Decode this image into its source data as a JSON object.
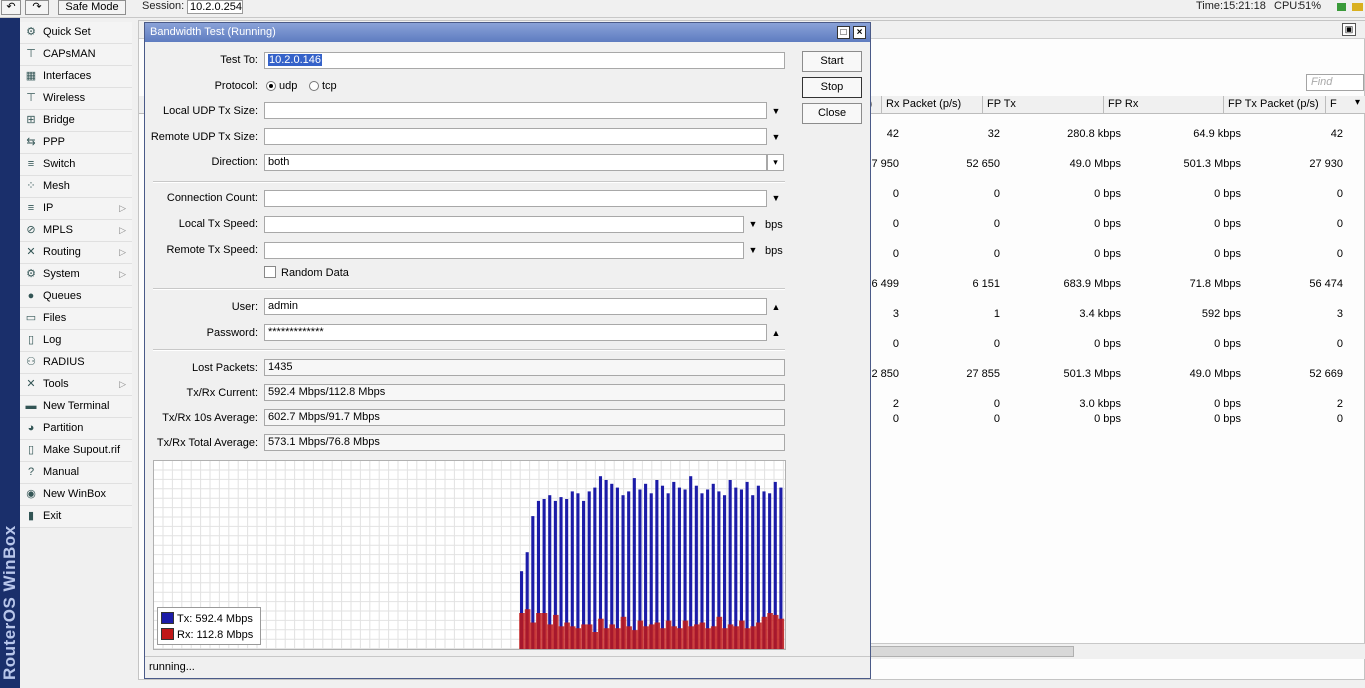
{
  "topbar": {
    "safe_mode": "Safe Mode",
    "session_label": "Session:",
    "session_value": "10.2.0.254",
    "time_label": "Time:",
    "time_value": "15:21:18",
    "cpu_label": "CPU:",
    "cpu_value": "51%"
  },
  "brand": "RouterOS WinBox",
  "menu": [
    {
      "label": "Quick Set",
      "icon": "quickset-icon",
      "glyph": "⚙"
    },
    {
      "label": "CAPsMAN",
      "icon": "capsman-icon",
      "glyph": "⊤"
    },
    {
      "label": "Interfaces",
      "icon": "interfaces-icon",
      "glyph": "▦"
    },
    {
      "label": "Wireless",
      "icon": "wireless-icon",
      "glyph": "⊤"
    },
    {
      "label": "Bridge",
      "icon": "bridge-icon",
      "glyph": "⊞"
    },
    {
      "label": "PPP",
      "icon": "ppp-icon",
      "glyph": "⇆"
    },
    {
      "label": "Switch",
      "icon": "switch-icon",
      "glyph": "≡"
    },
    {
      "label": "Mesh",
      "icon": "mesh-icon",
      "glyph": "⁘"
    },
    {
      "label": "IP",
      "icon": "ip-icon",
      "glyph": "≡",
      "sub": true
    },
    {
      "label": "MPLS",
      "icon": "mpls-icon",
      "glyph": "⊘",
      "sub": true
    },
    {
      "label": "Routing",
      "icon": "routing-icon",
      "glyph": "✕",
      "sub": true
    },
    {
      "label": "System",
      "icon": "system-icon",
      "glyph": "⚙",
      "sub": true
    },
    {
      "label": "Queues",
      "icon": "queues-icon",
      "glyph": "●"
    },
    {
      "label": "Files",
      "icon": "files-icon",
      "glyph": "▭"
    },
    {
      "label": "Log",
      "icon": "log-icon",
      "glyph": "▯"
    },
    {
      "label": "RADIUS",
      "icon": "radius-icon",
      "glyph": "⚇"
    },
    {
      "label": "Tools",
      "icon": "tools-icon",
      "glyph": "✕",
      "sub": true
    },
    {
      "label": "New Terminal",
      "icon": "terminal-icon",
      "glyph": "▬"
    },
    {
      "label": "Partition",
      "icon": "partition-icon",
      "glyph": "◕"
    },
    {
      "label": "Make Supout.rif",
      "icon": "supout-icon",
      "glyph": "▯"
    },
    {
      "label": "Manual",
      "icon": "manual-icon",
      "glyph": "?"
    },
    {
      "label": "New WinBox",
      "icon": "winbox-icon",
      "glyph": "◉"
    },
    {
      "label": "Exit",
      "icon": "exit-icon",
      "glyph": "▮"
    }
  ],
  "bgtable": {
    "find_placeholder": "Find",
    "headers": [
      "s)",
      "Rx Packet (p/s)",
      "FP Tx",
      "FP Rx",
      "FP Tx Packet (p/s)",
      "F"
    ],
    "rows": [
      [
        "42",
        "32",
        "280.8 kbps",
        "64.9 kbps",
        "42"
      ],
      [
        "7 950",
        "52 650",
        "49.0 Mbps",
        "501.3 Mbps",
        "27 930"
      ],
      [
        "0",
        "0",
        "0 bps",
        "0 bps",
        "0"
      ],
      [
        "0",
        "0",
        "0 bps",
        "0 bps",
        "0"
      ],
      [
        "0",
        "0",
        "0 bps",
        "0 bps",
        "0"
      ],
      [
        "6 499",
        "6 151",
        "683.9 Mbps",
        "71.8 Mbps",
        "56 474"
      ],
      [
        "3",
        "1",
        "3.4 kbps",
        "592 bps",
        "3"
      ],
      [
        "0",
        "0",
        "0 bps",
        "0 bps",
        "0"
      ],
      [
        "2 850",
        "27 855",
        "501.3 Mbps",
        "49.0 Mbps",
        "52 669"
      ],
      [
        "2",
        "0",
        "3.0 kbps",
        "0 bps",
        "2"
      ],
      [
        "0",
        "0",
        "0 bps",
        "0 bps",
        "0"
      ]
    ]
  },
  "dialog": {
    "title": "Bandwidth Test (Running)",
    "test_to_label": "Test To:",
    "test_to": "10.2.0.146",
    "protocol_label": "Protocol:",
    "udp": "udp",
    "tcp": "tcp",
    "local_udp_label": "Local UDP Tx Size:",
    "remote_udp_label": "Remote UDP Tx Size:",
    "direction_label": "Direction:",
    "direction": "both",
    "conn_count_label": "Connection Count:",
    "local_speed_label": "Local Tx Speed:",
    "remote_speed_label": "Remote Tx Speed:",
    "bps": "bps",
    "random_data": "Random Data",
    "user_label": "User:",
    "user": "admin",
    "password_label": "Password:",
    "password": "*************",
    "lost_label": "Lost Packets:",
    "lost": "1435",
    "current_label": "Tx/Rx Current:",
    "current": "592.4 Mbps/112.8 Mbps",
    "avg10_label": "Tx/Rx 10s Average:",
    "avg10": "602.7 Mbps/91.7 Mbps",
    "total_label": "Tx/Rx Total Average:",
    "total": "573.1 Mbps/76.8 Mbps",
    "start": "Start",
    "stop": "Stop",
    "close": "Close",
    "legend_tx": "Tx:  592.4 Mbps",
    "legend_rx": "Rx:  112.8 Mbps",
    "status": "running..."
  },
  "colors": {
    "tx": "#1c1ca8",
    "rx": "#c01818",
    "title": "#6f8ccb"
  },
  "graph": {
    "tx_series": [
      0.42,
      0.52,
      0.71,
      0.79,
      0.8,
      0.82,
      0.79,
      0.81,
      0.8,
      0.84,
      0.83,
      0.79,
      0.84,
      0.86,
      0.92,
      0.9,
      0.88,
      0.86,
      0.82,
      0.84,
      0.91,
      0.85,
      0.88,
      0.83,
      0.9,
      0.87,
      0.83,
      0.89,
      0.86,
      0.85,
      0.92,
      0.87,
      0.83,
      0.85,
      0.88,
      0.84,
      0.82,
      0.9,
      0.86,
      0.85,
      0.89,
      0.82,
      0.87,
      0.84,
      0.83,
      0.89,
      0.86
    ],
    "rx_series": [
      0.2,
      0.22,
      0.15,
      0.2,
      0.2,
      0.14,
      0.19,
      0.13,
      0.15,
      0.13,
      0.12,
      0.14,
      0.14,
      0.1,
      0.17,
      0.12,
      0.14,
      0.12,
      0.18,
      0.13,
      0.11,
      0.16,
      0.13,
      0.14,
      0.15,
      0.12,
      0.16,
      0.13,
      0.12,
      0.16,
      0.13,
      0.14,
      0.15,
      0.12,
      0.13,
      0.18,
      0.12,
      0.14,
      0.13,
      0.16,
      0.12,
      0.13,
      0.15,
      0.18,
      0.2,
      0.19,
      0.17
    ]
  }
}
